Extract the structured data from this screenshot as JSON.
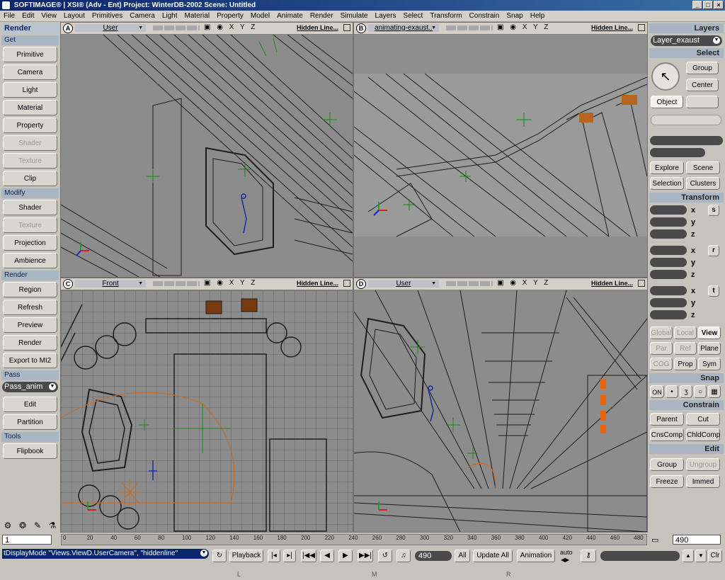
{
  "window": {
    "title": "SOFTIMAGE® | XSI® (Adv - Ent) Project: WinterDB-2002    Scene: Untitled",
    "controls": [
      "_",
      "□",
      "×"
    ]
  },
  "menu": [
    "File",
    "Edit",
    "View",
    "Layout",
    "Primitives",
    "Camera",
    "Light",
    "Material",
    "Property",
    "Model",
    "Animate",
    "Render",
    "Simulate",
    "Layers",
    "Select",
    "Transform",
    "Constrain",
    "Snap",
    "Help"
  ],
  "left_panel": {
    "title": "Render",
    "sections": [
      {
        "header": "Get",
        "buttons": [
          {
            "label": "Primitive",
            "enabled": true
          },
          {
            "label": "Camera",
            "enabled": true
          },
          {
            "label": "Light",
            "enabled": true
          },
          {
            "label": "Material",
            "enabled": true
          },
          {
            "label": "Property",
            "enabled": true
          },
          {
            "label": "Shader",
            "enabled": false
          },
          {
            "label": "Texture",
            "enabled": false
          },
          {
            "label": "Clip",
            "enabled": true
          }
        ]
      },
      {
        "header": "Modify",
        "buttons": [
          {
            "label": "Shader",
            "enabled": true
          },
          {
            "label": "Texture",
            "enabled": false
          },
          {
            "label": "Projection",
            "enabled": true
          },
          {
            "label": "Ambience",
            "enabled": true
          }
        ]
      },
      {
        "header": "Render",
        "buttons": [
          {
            "label": "Region",
            "enabled": true
          },
          {
            "label": "Refresh",
            "enabled": true
          },
          {
            "label": "Preview",
            "enabled": true
          },
          {
            "label": "Render",
            "enabled": true
          },
          {
            "label": "Export to MI2",
            "enabled": true
          }
        ]
      }
    ],
    "pass_header": "Pass",
    "pass_value": "Pass_anim",
    "pass_buttons": [
      "Edit",
      "Partition"
    ],
    "tools_header": "Tools",
    "tools_buttons": [
      "Flipbook"
    ]
  },
  "viewports": [
    {
      "letter": "A",
      "camera": "User",
      "axes": "X Y Z",
      "mode": "Hidden Line..."
    },
    {
      "letter": "B",
      "camera": "animating-exaust..",
      "axes": "X Y Z",
      "mode": "Hidden Line..."
    },
    {
      "letter": "C",
      "camera": "Front",
      "axes": "X Y Z",
      "mode": "Hidden Line..."
    },
    {
      "letter": "D",
      "camera": "User",
      "axes": "X Y Z",
      "mode": "Hidden Line..."
    }
  ],
  "right_panel": {
    "layers_title": "Layers",
    "layer_value": "Layer_exaust",
    "select_title": "Select",
    "select_buttons": {
      "group": "Group",
      "center": "Center",
      "object": "Object"
    },
    "explore_buttons": [
      "Explore",
      "Scene",
      "Selection",
      "Clusters"
    ],
    "transform_title": "Transform",
    "transform_groups": [
      {
        "icon": "s",
        "axes": [
          "x",
          "y",
          "z"
        ]
      },
      {
        "icon": "r",
        "axes": [
          "x",
          "y",
          "z"
        ]
      },
      {
        "icon": "t",
        "axes": [
          "x",
          "y",
          "z"
        ]
      }
    ],
    "ref_row1": [
      {
        "label": "Global",
        "state": "disabled"
      },
      {
        "label": "Local",
        "state": "disabled"
      },
      {
        "label": "View",
        "state": "selected"
      }
    ],
    "ref_row2": [
      {
        "label": "Par",
        "state": "disabled"
      },
      {
        "label": "Ref",
        "state": "disabled"
      },
      {
        "label": "Plane",
        "state": "normal"
      }
    ],
    "ref_row3": [
      {
        "label": "COG",
        "state": "disabled"
      },
      {
        "label": "Prop",
        "state": "normal"
      },
      {
        "label": "Sym",
        "state": "normal"
      }
    ],
    "snap_title": "Snap",
    "snap_on": "ON",
    "constrain_title": "Constrain",
    "constrain_buttons": [
      "Parent",
      "Cut",
      "CnsComp",
      "ChldComp"
    ],
    "edit_title": "Edit",
    "edit_buttons": [
      {
        "label": "Group",
        "enabled": true
      },
      {
        "label": "Ungroup",
        "enabled": false
      },
      {
        "label": "Freeze",
        "enabled": true
      },
      {
        "label": "Immed",
        "enabled": true
      }
    ]
  },
  "timeline": {
    "start_frame": "1",
    "end_frame": "490",
    "ticks": [
      "0",
      "20",
      "40",
      "60",
      "80",
      "100",
      "120",
      "140",
      "160",
      "180",
      "200",
      "220",
      "240",
      "260",
      "280",
      "300",
      "320",
      "340",
      "360",
      "380",
      "400",
      "420",
      "440",
      "460",
      "480"
    ]
  },
  "bottom_bar": {
    "command_text": "tDisplayMode \"Views.ViewD.UserCamera\", \"hiddenline\"",
    "playback_label": "Playback",
    "frame_value": "490",
    "all_label": "All",
    "update_label": "Update All",
    "animation_label": "Animation",
    "auto_label": "auto",
    "clr_label": "Clr",
    "mouse_labels": [
      "L",
      "M",
      "R"
    ]
  },
  "colors": {
    "title_bar": "#0a246a",
    "panel_bg": "#c6c3bd",
    "viewport_bg": "#8c8c8c",
    "wire_dark": "#202020",
    "helper_green": "#1a8a1a",
    "helper_orange": "#d06a1a",
    "helper_blue": "#1a2aa0"
  }
}
